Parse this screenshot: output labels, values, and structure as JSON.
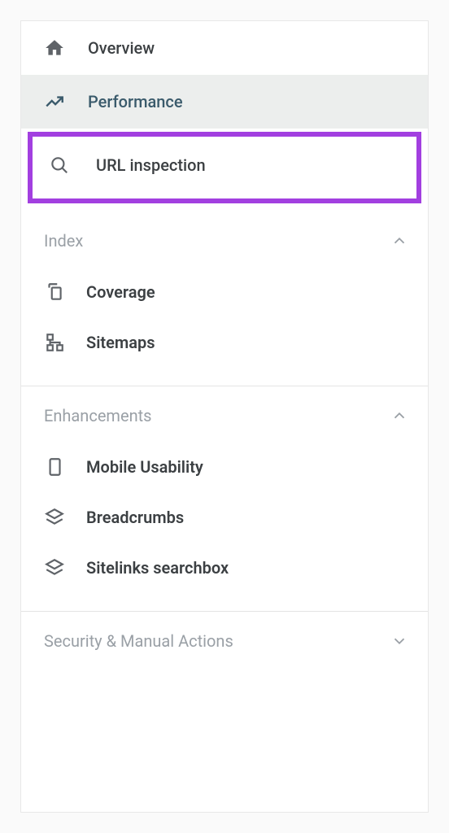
{
  "top_nav": [
    {
      "id": "overview",
      "label": "Overview",
      "icon": "home-icon",
      "selected": false,
      "highlighted": false
    },
    {
      "id": "performance",
      "label": "Performance",
      "icon": "trend-icon",
      "selected": true,
      "highlighted": false
    },
    {
      "id": "url-inspection",
      "label": "URL inspection",
      "icon": "search-icon",
      "selected": false,
      "highlighted": true
    }
  ],
  "sections": [
    {
      "id": "index",
      "title": "Index",
      "expanded": true,
      "items": [
        {
          "id": "coverage",
          "label": "Coverage",
          "icon": "pages-icon"
        },
        {
          "id": "sitemaps",
          "label": "Sitemaps",
          "icon": "sitemap-icon"
        }
      ]
    },
    {
      "id": "enhancements",
      "title": "Enhancements",
      "expanded": true,
      "items": [
        {
          "id": "mobile-usability",
          "label": "Mobile Usability",
          "icon": "mobile-icon"
        },
        {
          "id": "breadcrumbs",
          "label": "Breadcrumbs",
          "icon": "layers-icon"
        },
        {
          "id": "sitelinks-searchbox",
          "label": "Sitelinks searchbox",
          "icon": "layers-icon"
        }
      ]
    },
    {
      "id": "security-manual-actions",
      "title": "Security & Manual Actions",
      "expanded": false,
      "items": []
    }
  ],
  "colors": {
    "highlight": "#a23fe0",
    "selected_bg": "#eceeed",
    "text": "#3c4043",
    "muted": "#9aa0a6"
  }
}
